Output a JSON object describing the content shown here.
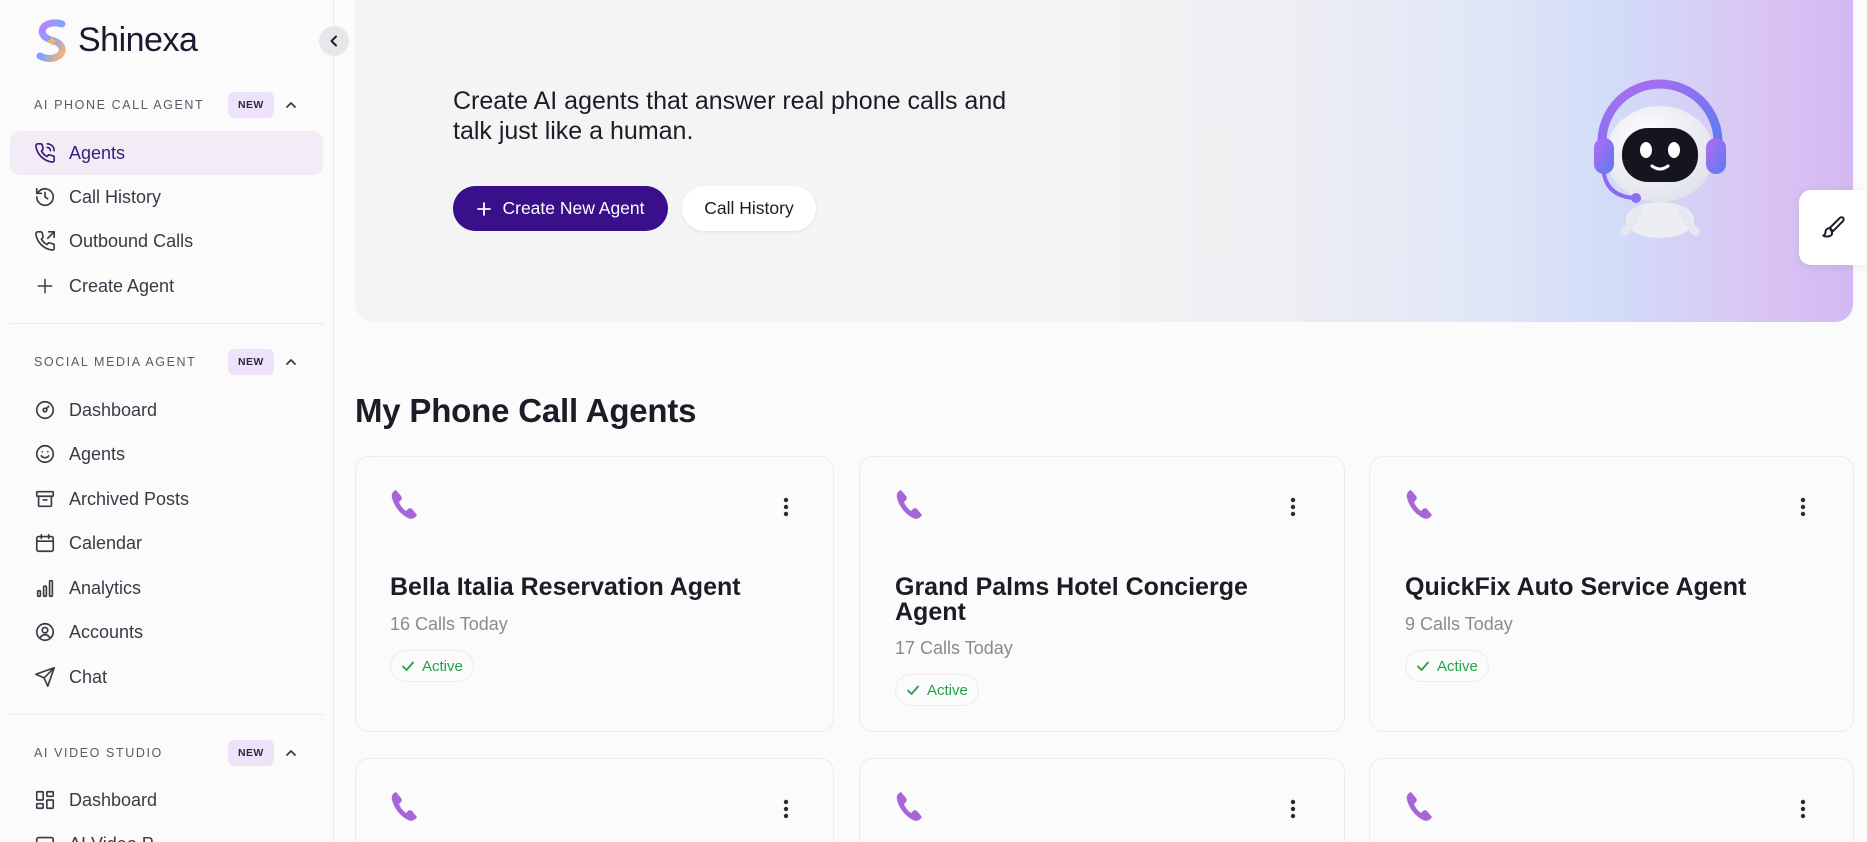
{
  "brand": {
    "name": "Shinexa"
  },
  "sidebar": {
    "sections": [
      {
        "title": "AI PHONE CALL AGENT",
        "badge": "NEW",
        "items": [
          {
            "label": "Agents",
            "icon": "phone-call-icon",
            "active": true
          },
          {
            "label": "Call History",
            "icon": "history-icon"
          },
          {
            "label": "Outbound Calls",
            "icon": "phone-outgoing-icon"
          },
          {
            "label": "Create Agent",
            "icon": "plus-icon"
          }
        ]
      },
      {
        "title": "SOCIAL MEDIA AGENT",
        "badge": "NEW",
        "items": [
          {
            "label": "Dashboard",
            "icon": "gauge-icon"
          },
          {
            "label": "Agents",
            "icon": "smile-icon"
          },
          {
            "label": "Archived Posts",
            "icon": "archive-icon"
          },
          {
            "label": "Calendar",
            "icon": "calendar-icon"
          },
          {
            "label": "Analytics",
            "icon": "bar-chart-icon"
          },
          {
            "label": "Accounts",
            "icon": "user-circle-icon"
          },
          {
            "label": "Chat",
            "icon": "send-icon"
          }
        ]
      },
      {
        "title": "AI VIDEO STUDIO",
        "badge": "NEW",
        "items": [
          {
            "label": "Dashboard",
            "icon": "layout-grid-icon"
          },
          {
            "label": "AI Video P",
            "icon": "video-icon"
          }
        ]
      }
    ]
  },
  "hero": {
    "title": "Create AI agents that answer real phone calls and talk just like a human.",
    "primary_button": "Create New Agent",
    "secondary_button": "Call History"
  },
  "main": {
    "section_title": "My Phone Call Agents",
    "agents": [
      {
        "name": "Bella Italia Reservation Agent",
        "calls": "16 Calls Today",
        "status": "Active"
      },
      {
        "name": "Grand Palms Hotel Concierge Agent",
        "calls": "17 Calls Today",
        "status": "Active"
      },
      {
        "name": "QuickFix Auto Service Agent",
        "calls": "9 Calls Today",
        "status": "Active"
      }
    ]
  },
  "colors": {
    "accent": "#3a0f8a",
    "active_nav_bg": "#f1ecf5",
    "status_green": "#22a24a",
    "phone_icon": "#a865d8"
  }
}
